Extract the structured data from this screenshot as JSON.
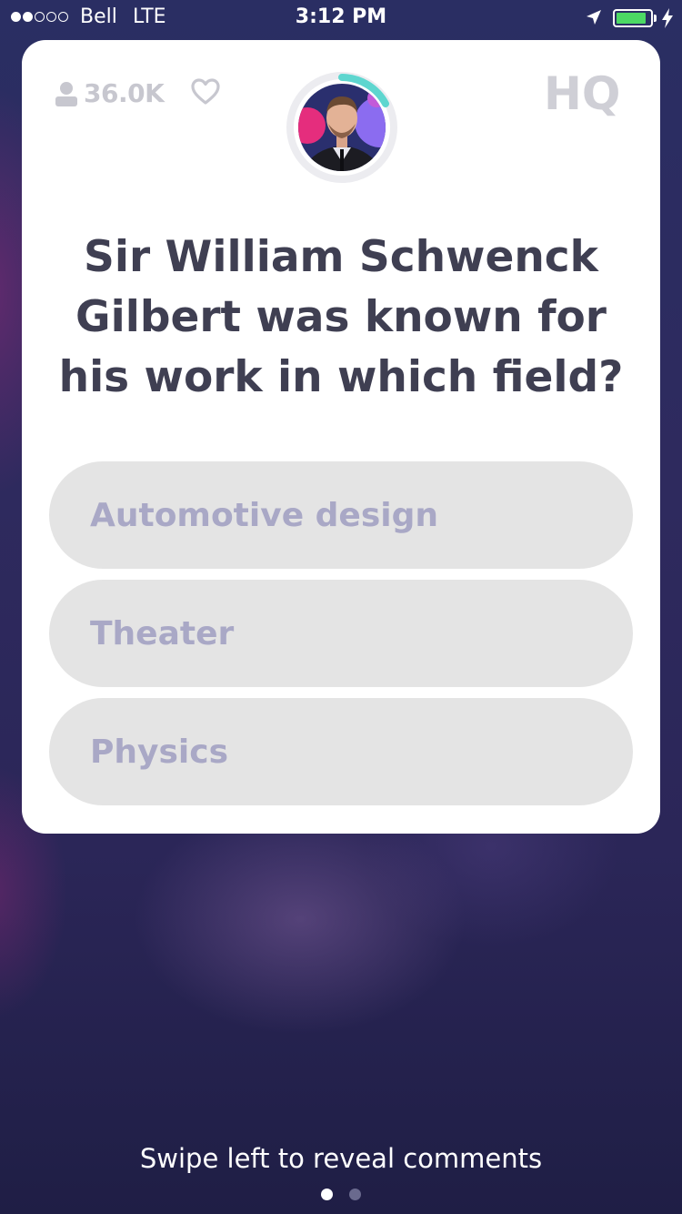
{
  "status_bar": {
    "carrier": "Bell",
    "network": "LTE",
    "time": "3:12 PM",
    "signal_bars_filled": 2,
    "signal_bars_total": 5,
    "battery_level": 0.9,
    "battery_color": "#4cd964",
    "icons": [
      "location-arrow-icon",
      "battery-icon",
      "charging-bolt-icon"
    ]
  },
  "card": {
    "viewer_count": "36.0K",
    "logo": "HQ",
    "timer_color": "#5ed6cf",
    "question": "Sir William Schwenck Gilbert was known for his work in which field?",
    "answers": [
      {
        "label": "Automotive design"
      },
      {
        "label": "Theater"
      },
      {
        "label": "Physics"
      }
    ]
  },
  "footer": {
    "hint": "Swipe left to reveal comments",
    "pages": 2,
    "active_page": 1
  },
  "colors": {
    "card_background": "#ffffff",
    "question_text": "#3f3f52",
    "answer_background": "#e4e4e4",
    "answer_text": "#a9a8c6",
    "muted_icons": "#c7c7cf"
  }
}
